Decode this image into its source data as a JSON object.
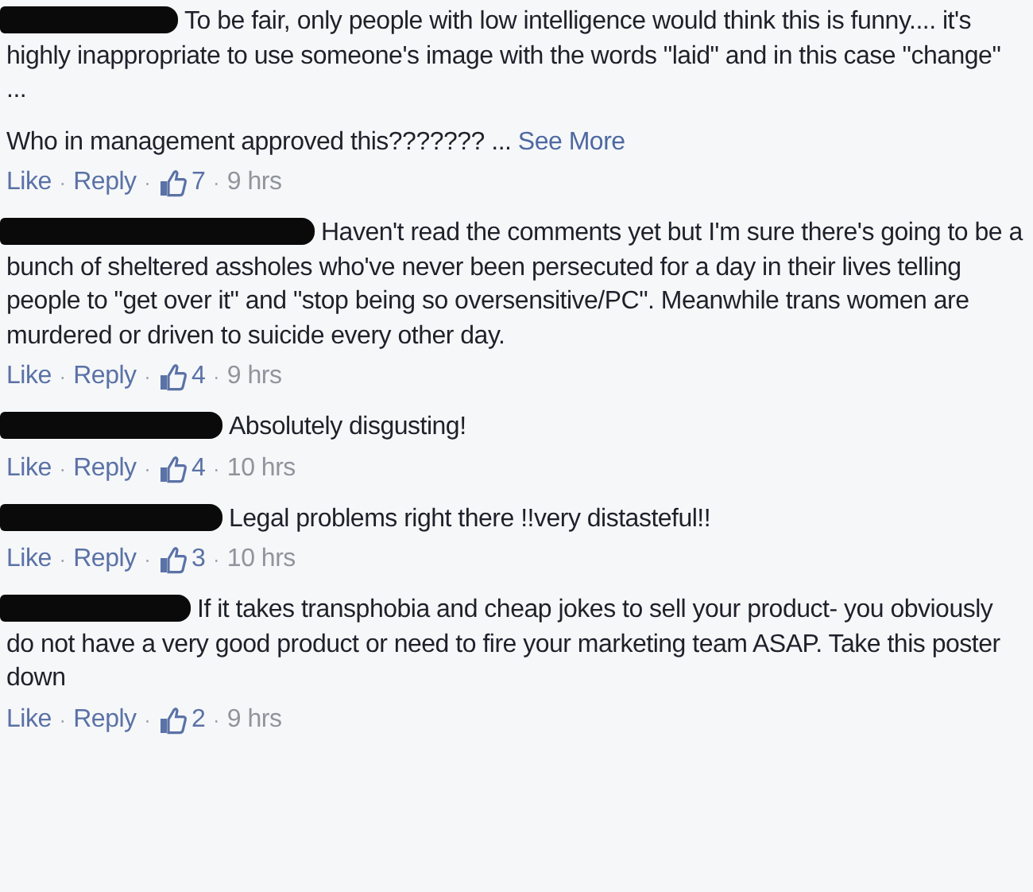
{
  "separator": "·",
  "comments": [
    {
      "paragraphs": [
        "To be fair, only people with low intelligence would think this is funny.... it's highly inappropriate to use someone's image with the words \"laid\" and in this case \"change\" ...",
        "Who in management approved this??????? ..."
      ],
      "see_more": "See More",
      "like": "Like",
      "reply": "Reply",
      "likes": "7",
      "time": "9 hrs"
    },
    {
      "paragraphs": [
        "Haven't read the comments yet but I'm sure there's going to be a bunch of sheltered assholes who've never been persecuted for a day in their lives telling people to \"get over it\" and \"stop being so oversensitive/PC\". Meanwhile trans women are murdered or driven to suicide every other day."
      ],
      "like": "Like",
      "reply": "Reply",
      "likes": "4",
      "time": "9 hrs"
    },
    {
      "paragraphs": [
        "Absolutely disgusting!"
      ],
      "like": "Like",
      "reply": "Reply",
      "likes": "4",
      "time": "10 hrs"
    },
    {
      "paragraphs": [
        "Legal problems right there !!very distasteful!!"
      ],
      "like": "Like",
      "reply": "Reply",
      "likes": "3",
      "time": "10 hrs"
    },
    {
      "paragraphs": [
        "If it takes transphobia and cheap jokes to sell your product- you obviously do not have a very good product or need to fire your marketing team ASAP. Take this poster down"
      ],
      "like": "Like",
      "reply": "Reply",
      "likes": "2",
      "time": "9 hrs"
    }
  ]
}
